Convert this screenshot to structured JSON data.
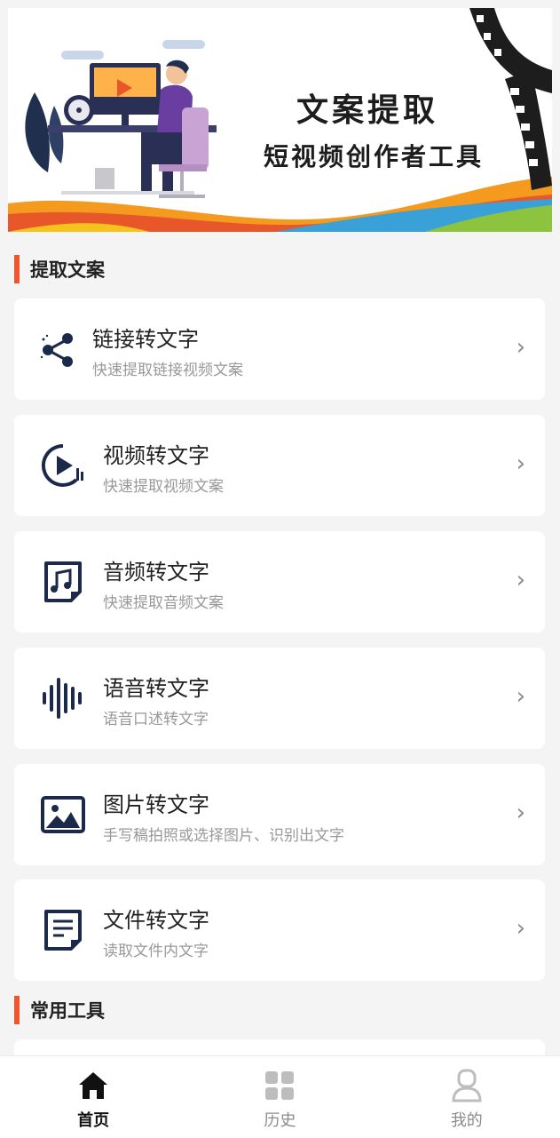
{
  "banner": {
    "title": "文案提取",
    "subtitle": "短视频创作者工具"
  },
  "sections": {
    "extract": "提取文案",
    "tools": "常用工具"
  },
  "cards": [
    {
      "title": "链接转文字",
      "desc": "快速提取链接视频文案",
      "icon": "share-link-icon"
    },
    {
      "title": "视频转文字",
      "desc": "快速提取视频文案",
      "icon": "video-play-icon"
    },
    {
      "title": "音频转文字",
      "desc": "快速提取音频文案",
      "icon": "music-note-icon"
    },
    {
      "title": "语音转文字",
      "desc": "语音口述转文字",
      "icon": "sound-wave-icon"
    },
    {
      "title": "图片转文字",
      "desc": "手写稿拍照或选择图片、识别出文字",
      "icon": "image-icon"
    },
    {
      "title": "文件转文字",
      "desc": "读取文件内文字",
      "icon": "document-icon"
    }
  ],
  "chevron": "›",
  "tabbar": {
    "home": "首页",
    "history": "历史",
    "mine": "我的"
  },
  "colors": {
    "accent": "#f0562d",
    "icon": "#1b2a4a",
    "background": "#f4f4f4"
  }
}
